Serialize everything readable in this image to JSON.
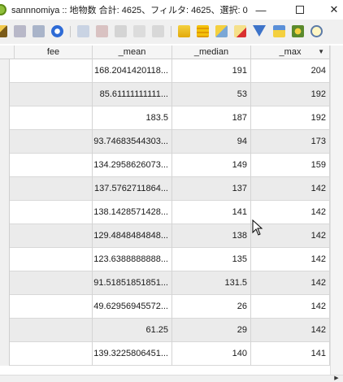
{
  "window": {
    "title": "sannnomiya :: 地物数 合計: 4625、フィルタ: 4625、選択: 0",
    "minimize_glyph": "—",
    "close_glyph": "✕"
  },
  "toolbar": {
    "icons": [
      "edit-pencil-icon",
      "toggle-edit-icon",
      "save-edits-icon",
      "reload-icon",
      "add-feature-icon",
      "delete-feature-icon",
      "cut-icon",
      "copy-icon",
      "paste-icon",
      "expression-select-icon",
      "select-all-icon",
      "invert-selection-icon",
      "deselect-icon",
      "filter-icon",
      "move-to-top-icon",
      "pan-to-selected-icon",
      "zoom-to-selected-icon"
    ]
  },
  "table": {
    "columns": [
      "fee",
      "_mean",
      "_median",
      "_max"
    ],
    "sort_indicator": "▼",
    "rows": [
      {
        "fee": "",
        "mean": "168.2041420118...",
        "median": "191",
        "max": "204"
      },
      {
        "fee": "",
        "mean": "85.61111111111...",
        "median": "53",
        "max": "192"
      },
      {
        "fee": "",
        "mean": "183.5",
        "median": "187",
        "max": "192"
      },
      {
        "fee": "",
        "mean": "93.74683544303...",
        "median": "94",
        "max": "173"
      },
      {
        "fee": "",
        "mean": "134.2958626073...",
        "median": "149",
        "max": "159"
      },
      {
        "fee": "",
        "mean": "137.5762711864...",
        "median": "137",
        "max": "142"
      },
      {
        "fee": "",
        "mean": "138.1428571428...",
        "median": "141",
        "max": "142"
      },
      {
        "fee": "",
        "mean": "129.4848484848...",
        "median": "138",
        "max": "142"
      },
      {
        "fee": "",
        "mean": "123.6388888888...",
        "median": "135",
        "max": "142"
      },
      {
        "fee": "",
        "mean": "91.51851851851...",
        "median": "131.5",
        "max": "142"
      },
      {
        "fee": "",
        "mean": "49.62956945572...",
        "median": "26",
        "max": "142"
      },
      {
        "fee": "",
        "mean": "61.25",
        "median": "29",
        "max": "142"
      },
      {
        "fee": "",
        "mean": "139.3225806451...",
        "median": "140",
        "max": "141"
      }
    ]
  },
  "colors": {
    "alt_row": "#ebebeb",
    "header_bg": "#f5f5f5",
    "toolbar_bg": "#f0f0f0"
  }
}
